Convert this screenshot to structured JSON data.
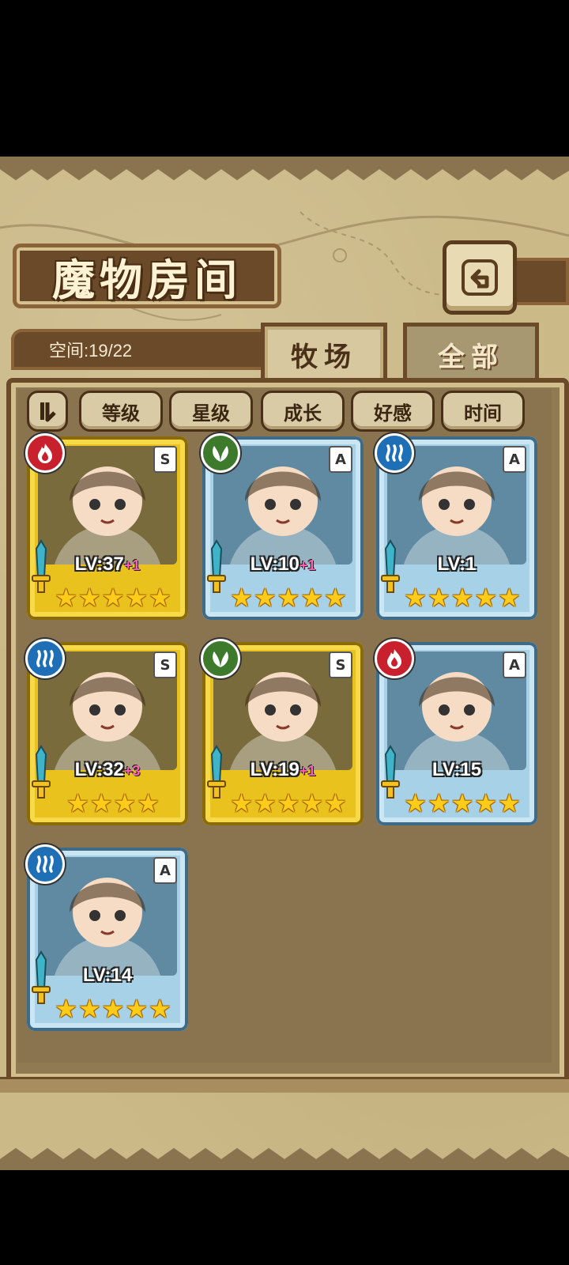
{
  "header": {
    "title": "魔物房间",
    "space_label": "空间:19/22"
  },
  "tabs": [
    {
      "label": "牧场",
      "active": true
    },
    {
      "label": "全部",
      "active": false
    }
  ],
  "sort_buttons": [
    "等级",
    "星级",
    "成长",
    "好感",
    "时间"
  ],
  "colors": {
    "fire": "#c8202c",
    "grass": "#3d7a2c",
    "water": "#1e6fb6",
    "gold_frame": "#e9c21e",
    "blue_frame": "#a7d1e6"
  },
  "monsters": [
    {
      "element": "fire",
      "rank": "S",
      "frame": "gold",
      "lv": "LV:37",
      "plus": "+1",
      "stars": 5
    },
    {
      "element": "grass",
      "rank": "A",
      "frame": "blue",
      "lv": "LV:10",
      "plus": "+1",
      "stars": 5
    },
    {
      "element": "water",
      "rank": "A",
      "frame": "blue",
      "lv": "LV:1",
      "plus": "",
      "stars": 5
    },
    {
      "element": "water",
      "rank": "S",
      "frame": "gold",
      "lv": "LV:32",
      "plus": "+3",
      "stars": 4
    },
    {
      "element": "grass",
      "rank": "S",
      "frame": "gold",
      "lv": "LV:19",
      "plus": "+1",
      "stars": 5
    },
    {
      "element": "fire",
      "rank": "A",
      "frame": "blue",
      "lv": "LV:15",
      "plus": "",
      "stars": 5
    },
    {
      "element": "water",
      "rank": "A",
      "frame": "blue",
      "lv": "LV:14",
      "plus": "",
      "stars": 5
    }
  ]
}
